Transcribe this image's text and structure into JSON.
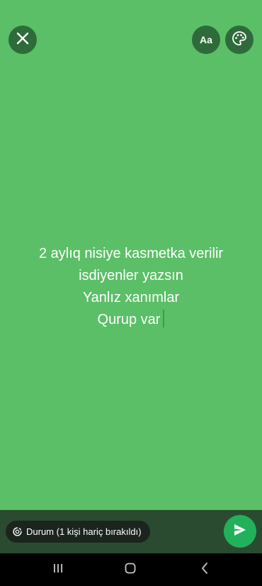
{
  "editor": {
    "background_color": "#5bbf67",
    "lines": [
      "2 aylıq nisiye kasmetka verilir",
      "isdiyenler yazsın",
      "Yanlız xanımlar",
      "Qurup var"
    ]
  },
  "toolbar": {
    "close_icon": "close-icon",
    "font_label": "Aa",
    "palette_icon": "palette-icon"
  },
  "footer": {
    "audience_label": "Durum (1 kişi hariç bırakıldı)",
    "audience_icon": "status-icon",
    "send_icon": "send-icon"
  },
  "navigation": {
    "items": [
      "recents-icon",
      "home-icon",
      "back-icon"
    ]
  }
}
